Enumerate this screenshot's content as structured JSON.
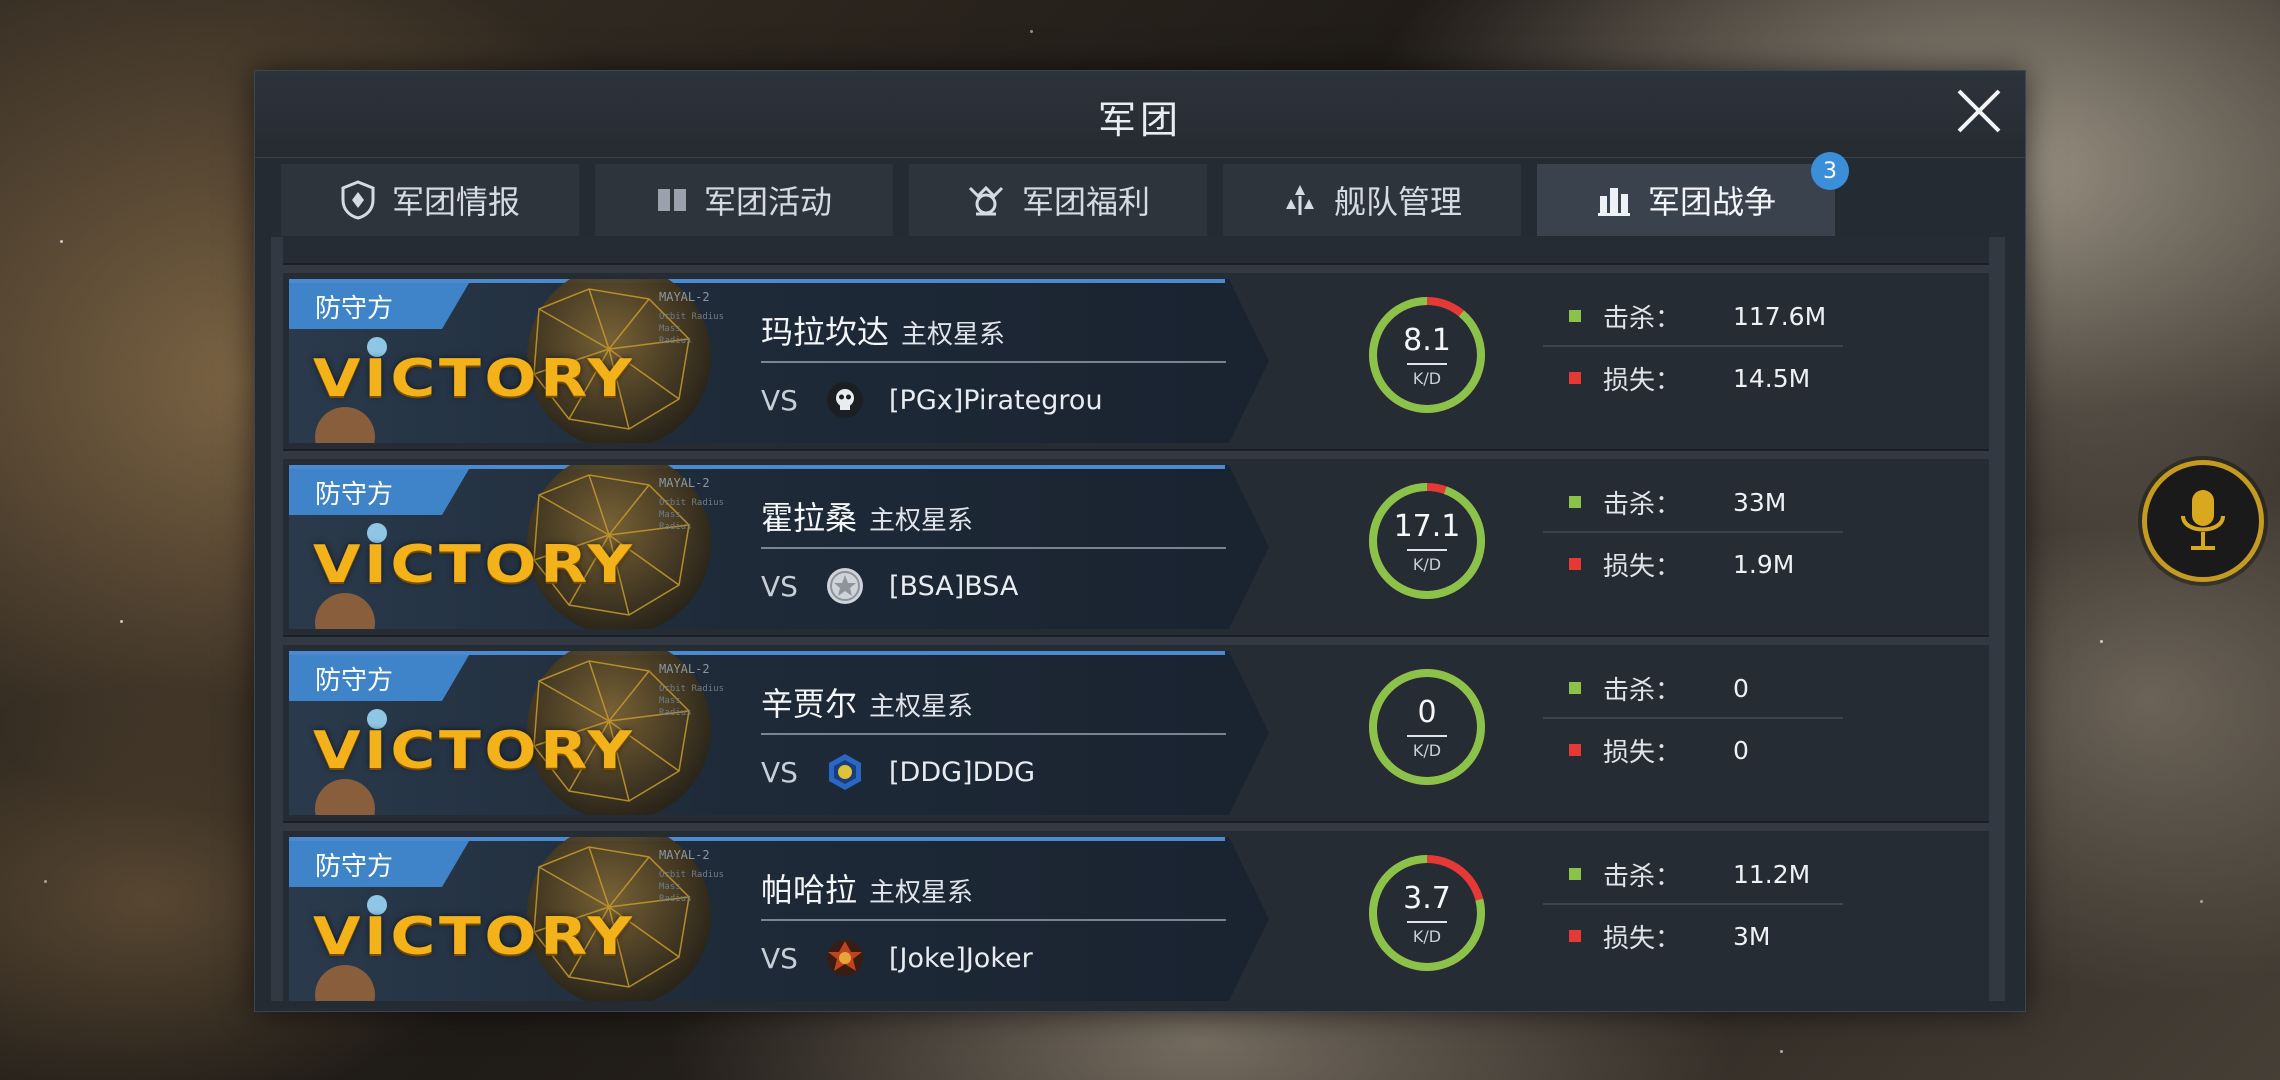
{
  "window": {
    "title": "军团",
    "close_icon": "close-icon"
  },
  "tabs": [
    {
      "label": "军团情报",
      "icon": "shield-icon",
      "active": false
    },
    {
      "label": "军团活动",
      "icon": "book-icon",
      "active": false
    },
    {
      "label": "军团福利",
      "icon": "gift-icon",
      "active": false
    },
    {
      "label": "舰队管理",
      "icon": "fleet-icon",
      "active": false
    },
    {
      "label": "军团战争",
      "icon": "war-icon",
      "active": true,
      "badge": "3"
    }
  ],
  "wars": [
    {
      "side": "防守方",
      "result": "VICTORY",
      "system": "玛拉坎达",
      "system_type": "主权星系",
      "vs": "VS",
      "opponent": "[PGx]Pirategrou",
      "opponent_logo": "skull-logo-icon",
      "kd": "8.1",
      "kd_label": "K/D",
      "kd_ratio": 0.89,
      "kill_label": "击杀：",
      "kill": "117.6M",
      "loss_label": "损失：",
      "loss": "14.5M"
    },
    {
      "side": "防守方",
      "result": "VICTORY",
      "system": "霍拉桑",
      "system_type": "主权星系",
      "vs": "VS",
      "opponent": "[BSA]BSA",
      "opponent_logo": "star-logo-icon",
      "kd": "17.1",
      "kd_label": "K/D",
      "kd_ratio": 0.945,
      "kill_label": "击杀：",
      "kill": "33M",
      "loss_label": "损失：",
      "loss": "1.9M"
    },
    {
      "side": "防守方",
      "result": "VICTORY",
      "system": "辛贾尔",
      "system_type": "主权星系",
      "vs": "VS",
      "opponent": "[DDG]DDG",
      "opponent_logo": "hexagon-logo-icon",
      "kd": "0",
      "kd_label": "K/D",
      "kd_ratio": 1.0,
      "kill_label": "击杀：",
      "kill": "0",
      "loss_label": "损失：",
      "loss": "0"
    },
    {
      "side": "防守方",
      "result": "VICTORY",
      "system": "帕哈拉",
      "system_type": "主权星系",
      "vs": "VS",
      "opponent": "[Joke]Joker",
      "opponent_logo": "joker-logo-icon",
      "kd": "3.7",
      "kd_label": "K/D",
      "kd_ratio": 0.79,
      "kill_label": "击杀：",
      "kill": "11.2M",
      "loss_label": "损失：",
      "loss": "3M"
    }
  ],
  "colors": {
    "accent_blue": "#3f84c9",
    "victory_gold": "#f3b21a",
    "kill_green": "#8bc34a",
    "loss_red": "#e53935",
    "badge_blue": "#3b8fd8"
  },
  "floating": {
    "mic_icon": "microphone-icon"
  }
}
